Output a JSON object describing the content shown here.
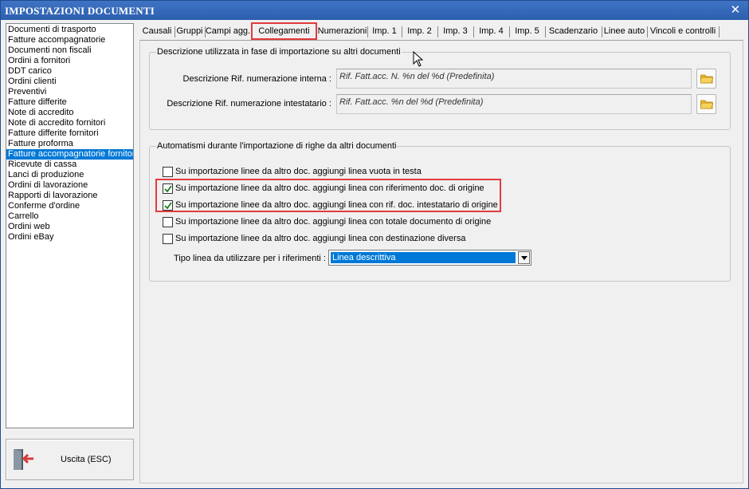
{
  "window": {
    "title": "IMPOSTAZIONI DOCUMENTI",
    "close_icon": "close-icon"
  },
  "doc_list": {
    "items": [
      "Documenti di trasporto",
      "Fatture accompagnatorie",
      "Documenti non fiscali",
      "Ordini a fornitori",
      "DDT carico",
      "Ordini clienti",
      "Preventivi",
      "Fatture differite",
      "Note di accredito",
      "Note di accredito fornitori",
      "Fatture differite fornitori",
      "Fatture proforma",
      "Fatture accompagnatorie fornitori",
      "Ricevute di cassa",
      "Lanci di produzione",
      "Ordini di lavorazione",
      "Rapporti di lavorazione",
      "Conferme d'ordine",
      "Carrello",
      "Ordini web",
      "Ordini eBay"
    ],
    "selected_index": 12
  },
  "exit_button": {
    "label": "Uscita (ESC)",
    "icon": "exit-door-icon"
  },
  "tabs": [
    {
      "label": "Causali",
      "active": false
    },
    {
      "label": "Gruppi",
      "active": false
    },
    {
      "label": "Campi agg.",
      "active": false
    },
    {
      "label": "Collegamenti",
      "active": true
    },
    {
      "label": "Numerazioni",
      "active": false
    },
    {
      "label": "Imp. 1",
      "active": false
    },
    {
      "label": "Imp. 2",
      "active": false
    },
    {
      "label": "Imp. 3",
      "active": false
    },
    {
      "label": "Imp. 4",
      "active": false
    },
    {
      "label": "Imp. 5",
      "active": false
    },
    {
      "label": "Scadenzario",
      "active": false
    },
    {
      "label": "Linee auto",
      "active": false
    },
    {
      "label": "Vincoli e controlli",
      "active": false
    }
  ],
  "descrizione_group": {
    "title": "Descrizione utilizzata in fase di importazione su altri documenti",
    "interna": {
      "label": "Descrizione Rif. numerazione interna :",
      "value": "Rif. Fatt.acc. N. %n del %d (Predefinita)",
      "button_icon": "folder-icon"
    },
    "intestatario": {
      "label": "Descrizione Rif. numerazione intestatario :",
      "value": "Rif. Fatt.acc. %n del %d (Predefinita)",
      "button_icon": "folder-icon"
    }
  },
  "automatismi_group": {
    "title": "Automatismi durante l'importazione di righe da altri documenti",
    "options": [
      {
        "label": "Su importazione linee da altro doc. aggiungi linea vuota in testa",
        "checked": false
      },
      {
        "label": "Su importazione linee da altro doc. aggiungi linea con riferimento doc. di origine",
        "checked": true
      },
      {
        "label": "Su importazione linee da altro doc. aggiungi linea con rif. doc. intestatario di origine",
        "checked": true
      },
      {
        "label": "Su importazione linee da altro doc. aggiungi linea con totale documento di origine",
        "checked": false
      },
      {
        "label": "Su importazione linee da altro doc. aggiungi linea con destinazione diversa",
        "checked": false
      }
    ],
    "tipo_linea": {
      "label": "Tipo linea da utilizzare per i riferimenti :",
      "value": "Linea descrittiva"
    }
  },
  "colors": {
    "title_bar": "#2c5eae",
    "selection": "#0078d7",
    "highlight": "#e23b3b"
  }
}
